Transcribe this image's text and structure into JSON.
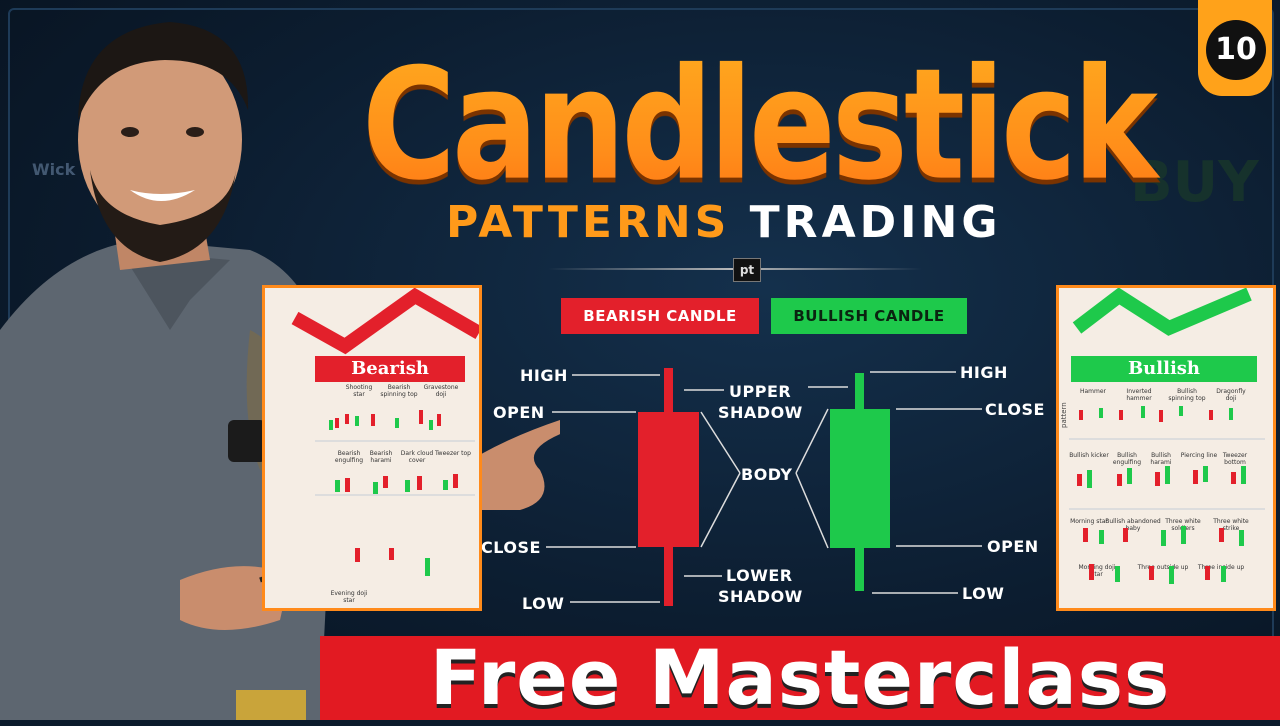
{
  "badge": {
    "number": "10"
  },
  "title": {
    "main": "Candlestick",
    "sub_part1": "PATTERNS",
    "sub_part2": "TRADING"
  },
  "logo": {
    "text": "pt"
  },
  "tags": {
    "bearish": "BEARISH CANDLE",
    "bullish": "BULLISH CANDLE"
  },
  "bearish_labels": {
    "high": "HIGH",
    "open": "OPEN",
    "close": "CLOSE",
    "low": "LOW"
  },
  "center_labels": {
    "upper_shadow_1": "UPPER",
    "upper_shadow_2": "SHADOW",
    "body": "BODY",
    "lower_shadow_1": "LOWER",
    "lower_shadow_2": "SHADOW"
  },
  "bullish_labels": {
    "high": "HIGH",
    "close": "CLOSE",
    "open": "OPEN",
    "low": "LOW"
  },
  "left_card": {
    "banner": "Bearish",
    "items": [
      "Shooting star",
      "Bearish spinning top",
      "Gravestone doji",
      "Bearish engulfing",
      "Bearish harami",
      "Dark cloud cover",
      "Tweezer top",
      "Evening doji star"
    ]
  },
  "right_card": {
    "banner": "Bullish",
    "side_label": "pattern",
    "items": [
      "Hammer",
      "Inverted hammer",
      "Bullish spinning top",
      "Dragonfly doji",
      "Bullish kicker",
      "Bullish engulfing",
      "Bullish harami",
      "Piercing line",
      "Tweezer bottom",
      "Morning star",
      "Bullish abandoned baby",
      "Three white soldiers",
      "Three white strike",
      "Morning doji star",
      "Three outside up",
      "Three inside up"
    ]
  },
  "background": {
    "word1": "BUY",
    "word2": "Wick"
  },
  "footer": {
    "text": "Free Masterclass"
  },
  "colors": {
    "bearish": "#e3202b",
    "bullish": "#1ec94b",
    "accent": "#ff9a1a"
  }
}
